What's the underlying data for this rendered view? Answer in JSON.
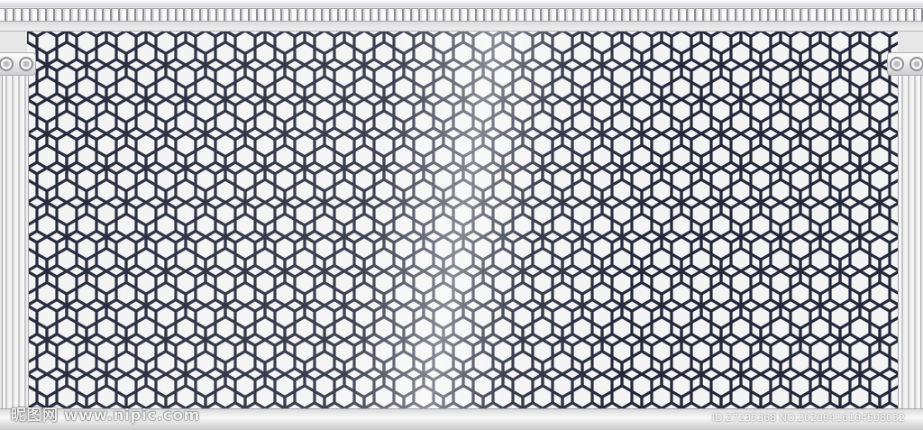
{
  "scene": {
    "description_colors": {
      "line": "#22283a",
      "background": "#f4f4f5",
      "frame": "#e7e7e8"
    },
    "pattern": {
      "motif": "hexagonal star / rhombus lattice"
    }
  },
  "watermark": {
    "text": "昵图网 www.nipic.com"
  },
  "stamp": {
    "text": "ID:27235368 NO:20200416104508032"
  }
}
